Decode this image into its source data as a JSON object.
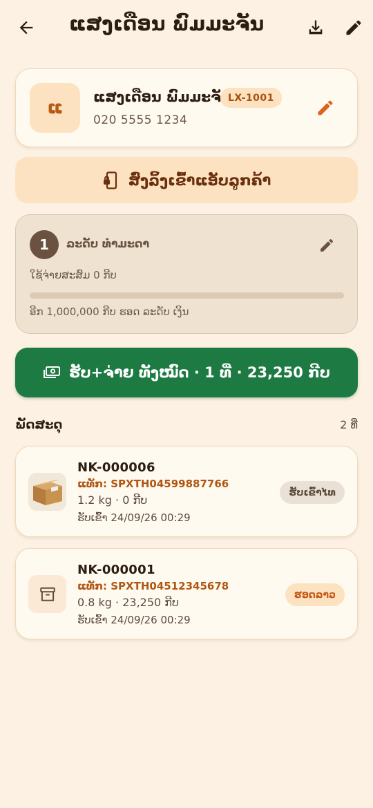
{
  "header": {
    "title": "ແສງເດືອນ ພົມມະຈັນ",
    "back_icon": "arrow-left-icon",
    "download_icon": "download-icon",
    "edit_icon": "pencil-icon"
  },
  "profile": {
    "avatar_letter": "ແ",
    "name": "ແສງເດືອນ ພົມມະຈັນ",
    "code": "LX-1001",
    "phone": "020 5555 1234",
    "edit_icon": "pencil-icon"
  },
  "send_link": {
    "label": "ສົ່ງລິ້ງເຂົ້າແອັບລູກຄ້າ",
    "icon": "phone-lock-icon"
  },
  "level": {
    "number": "1",
    "name": "ລະດັບ ທຳມະດາ",
    "spent": "ໃຊ້ຈ່າຍສະສົມ 0 ກີບ",
    "progress_percent": 0,
    "next": "ອີກ 1,000,000 ກີບ ຮອດ ລະດັບ ເງິນ",
    "edit_icon": "pencil-icon"
  },
  "pay_button": {
    "label": "ຮັບ+ຈ່າຍ ທັງໝົດ · 1 ທີ່ · 23,250 ກີບ",
    "icon": "cash-icon"
  },
  "parcels_section": {
    "title": "ພັດສະດຸ",
    "count": "2 ທີ່",
    "items": [
      {
        "id": "NK-000006",
        "tracking": "ແທັກ: SPXTH04599887766",
        "weight_price": "1.2 kg · 0 ກີບ",
        "received": "ຮັບເຂົ້າ 24/09/26 00:29",
        "status": "ຮັບເຂົ້າໄທ",
        "thumb_icon": "cardboard-box-icon"
      },
      {
        "id": "NK-000001",
        "tracking": "ແທັກ: SPXTH04512345678",
        "weight_price": "0.8 kg · 23,250 ກີບ",
        "received": "ຮັບເຂົ້າ 24/09/26 00:29",
        "status": "ຮອດລາວ",
        "thumb_icon": "archive-icon"
      }
    ]
  },
  "colors": {
    "background": "#fcf1e3",
    "accent_orange": "#c45512",
    "pay_green": "#1c7a42",
    "level_brown": "#6b5240"
  }
}
